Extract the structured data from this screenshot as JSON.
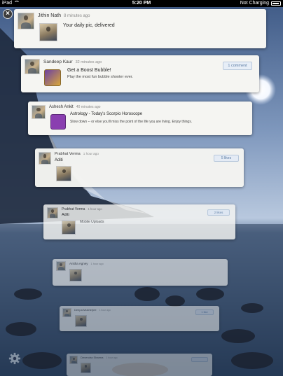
{
  "status": {
    "device": "iPad",
    "time": "5:20 PM",
    "battery": "Not Charging"
  },
  "cards": [
    {
      "user": "Jithin Nath",
      "time": "8 minutes ago",
      "message": "Your daily pic, delivered",
      "sub": "",
      "badge": ""
    },
    {
      "user": "Sandeep Kaur",
      "time": "32 minutes ago",
      "message": "Get a Boost Bubble!",
      "sub": "Play the most fun bubble shooter ever.",
      "badge": "1 comment"
    },
    {
      "user": "Ashesh Ankit",
      "time": "40 minutes ago",
      "message": "Astrology - Today's Scorpio Horoscope",
      "sub": "Slow down -- or else you'll miss the point of the life you are living. Enjoy things.",
      "badge": ""
    },
    {
      "user": "Prabhat Verma",
      "time": "1 hour ago",
      "message": "Aditi",
      "sub": "",
      "badge": "5 likes"
    },
    {
      "user": "Prabhat Verma",
      "time": "1 hour ago",
      "message": "Aditi",
      "sub": "Mobile Uploads",
      "badge": "2 likes"
    },
    {
      "user": "Anitha Agney",
      "time": "1 hour ago",
      "message": "",
      "sub": "",
      "badge": ""
    },
    {
      "user": "Deepa Mukherjee",
      "time": "1 hour ago",
      "message": "",
      "sub": "",
      "badge": "1 like"
    },
    {
      "user": "Devendra Sharma",
      "time": "1 hour ago",
      "message": "",
      "sub": "",
      "badge": ""
    }
  ],
  "colors": {
    "accent": "#5577a0",
    "card": "#f5f5f2"
  },
  "icons": {
    "close": "close-icon",
    "settings": "gear-icon"
  }
}
